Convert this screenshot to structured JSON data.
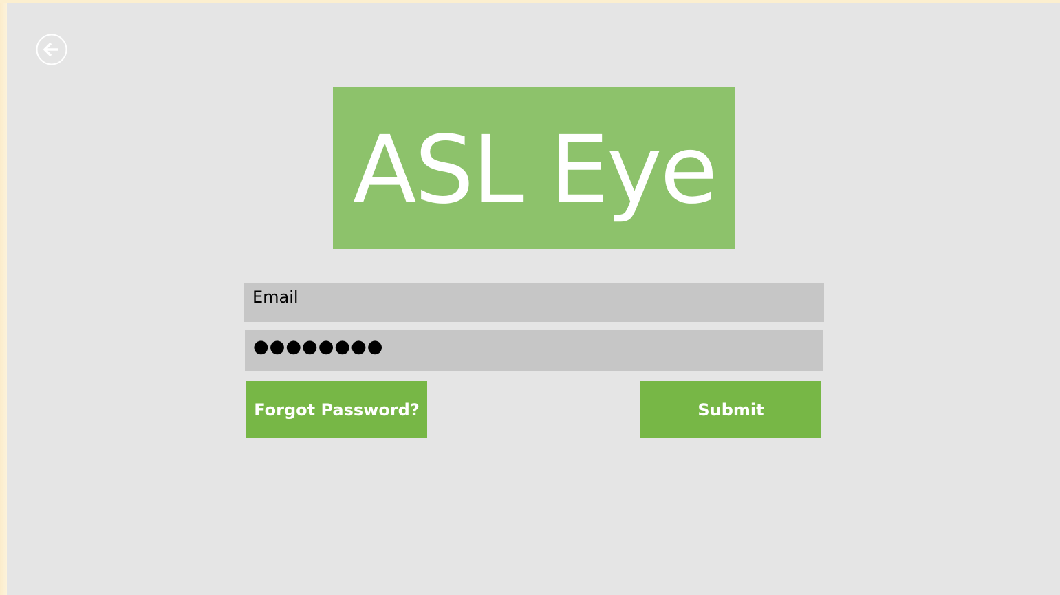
{
  "app": {
    "logo_text": "ASL Eye",
    "back_icon": "arrow-left-circle-icon"
  },
  "login": {
    "email_value": "Email",
    "password_mask": "●●●●●●●●",
    "forgot_label": "Forgot Password?",
    "submit_label": "Submit"
  },
  "colors": {
    "background": "#e5e5e5",
    "logo_green": "#8dc26b",
    "button_green": "#77b746",
    "field_gray": "#c6c6c6"
  }
}
